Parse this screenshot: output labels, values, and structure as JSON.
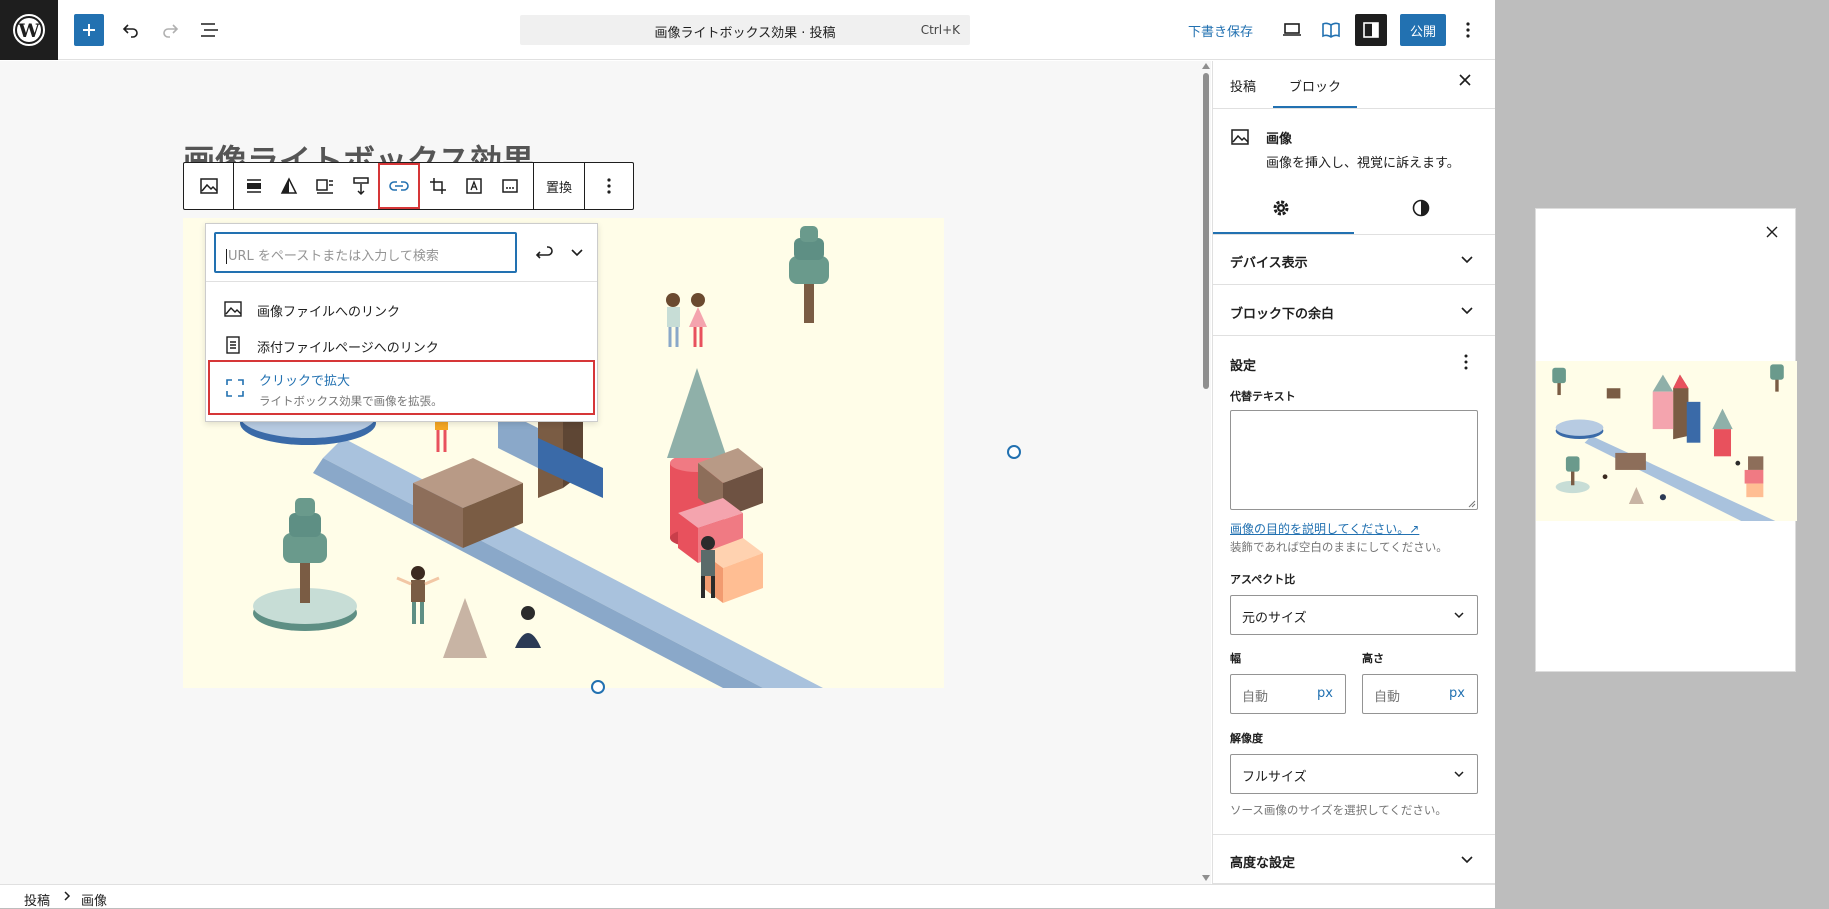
{
  "header": {
    "document_title": "画像ライトボックス効果 · 投稿",
    "command_shortcut": "Ctrl+K",
    "save_draft_label": "下書き保存",
    "publish_label": "公開"
  },
  "editor": {
    "post_title": "画像ライトボックス効果",
    "toolbar": {
      "replace_label": "置換"
    },
    "link_popover": {
      "url_placeholder": "URL をペーストまたは入力して検索",
      "items": [
        {
          "label": "画像ファイルへのリンク"
        },
        {
          "label": "添付ファイルページへのリンク"
        }
      ],
      "lightbox": {
        "label": "クリックで拡大",
        "description": "ライトボックス効果で画像を拡張。"
      }
    }
  },
  "breadcrumb": {
    "items": [
      "投稿",
      "画像"
    ]
  },
  "sidebar": {
    "tabs": {
      "post": "投稿",
      "block": "ブロック"
    },
    "block_card": {
      "title": "画像",
      "description": "画像を挿入し、視覚に訴えます。"
    },
    "panels": {
      "device": "デバイス表示",
      "block_spacing": "ブロック下の余白",
      "advanced": "高度な設定"
    },
    "settings": {
      "title": "設定",
      "alt_label": "代替テキスト",
      "alt_link": "画像の目的を説明してください。↗",
      "alt_help": "装飾であれば空白のままにしてください。",
      "aspect_label": "アスペクト比",
      "aspect_value": "元のサイズ",
      "width_label": "幅",
      "height_label": "高さ",
      "width_value": "自動",
      "height_value": "自動",
      "unit": "px",
      "resolution_label": "解像度",
      "resolution_value": "フルサイズ",
      "resolution_help": "ソース画像のサイズを選択してください。"
    }
  },
  "colors": {
    "accent": "#2271b1",
    "highlight": "#d63638",
    "dark": "#1e1e1e",
    "image_bg": "#fffde8"
  }
}
